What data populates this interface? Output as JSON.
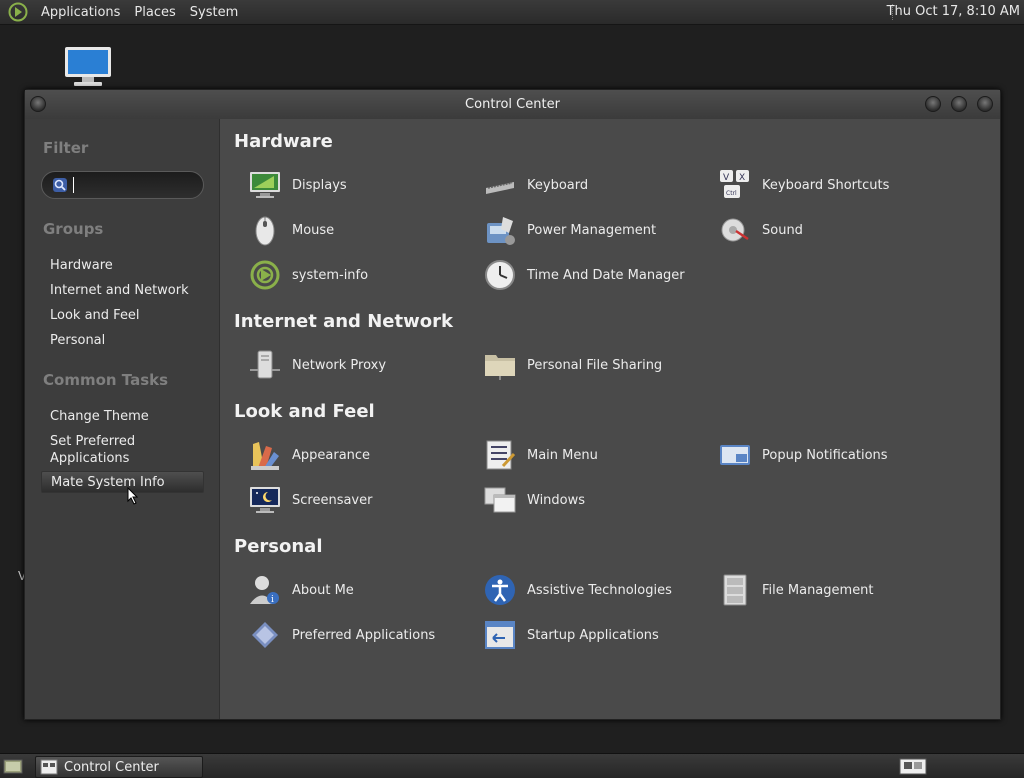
{
  "top_panel": {
    "menus": [
      "Applications",
      "Places",
      "System"
    ],
    "clock": "Thu Oct 17,  8:10 AM"
  },
  "desktop": {
    "stray_text": "V"
  },
  "window": {
    "title": "Control Center",
    "sidebar": {
      "filter_title": "Filter",
      "filter_value": "",
      "groups_title": "Groups",
      "groups": [
        "Hardware",
        "Internet and Network",
        "Look and Feel",
        "Personal"
      ],
      "tasks_title": "Common Tasks",
      "tasks": [
        "Change Theme",
        "Set Preferred\nApplications",
        "Mate System Info"
      ],
      "selected_task": "Mate System Info"
    },
    "groups": [
      {
        "title": "Hardware",
        "items": [
          {
            "label": "Displays",
            "icon": "display-icon"
          },
          {
            "label": "Keyboard",
            "icon": "keyboard-icon"
          },
          {
            "label": "Keyboard Shortcuts",
            "icon": "keyboard-shortcuts-icon"
          },
          {
            "label": "Mouse",
            "icon": "mouse-icon"
          },
          {
            "label": "Power Management",
            "icon": "power-management-icon"
          },
          {
            "label": "Sound",
            "icon": "sound-icon"
          },
          {
            "label": "system-info",
            "icon": "system-info-icon"
          },
          {
            "label": "Time And Date Manager",
            "icon": "clock-icon"
          }
        ]
      },
      {
        "title": "Internet and Network",
        "items": [
          {
            "label": "Network Proxy",
            "icon": "network-proxy-icon"
          },
          {
            "label": "Personal File Sharing",
            "icon": "folder-share-icon"
          }
        ]
      },
      {
        "title": "Look and Feel",
        "items": [
          {
            "label": "Appearance",
            "icon": "appearance-icon"
          },
          {
            "label": "Main Menu",
            "icon": "main-menu-icon"
          },
          {
            "label": "Popup Notifications",
            "icon": "popup-notifications-icon"
          },
          {
            "label": "Screensaver",
            "icon": "screensaver-icon"
          },
          {
            "label": "Windows",
            "icon": "windows-icon"
          }
        ]
      },
      {
        "title": "Personal",
        "items": [
          {
            "label": "About Me",
            "icon": "about-me-icon"
          },
          {
            "label": "Assistive Technologies",
            "icon": "accessibility-icon"
          },
          {
            "label": "File Management",
            "icon": "file-cabinet-icon"
          },
          {
            "label": "Preferred Applications",
            "icon": "preferred-apps-icon"
          },
          {
            "label": "Startup Applications",
            "icon": "startup-apps-icon"
          }
        ]
      }
    ]
  },
  "taskbar": {
    "task_label": "Control Center"
  },
  "colors": {
    "window_bg": "#4a4a4a",
    "sidebar_bg": "#3d3d3d",
    "section_title": "#7f7f7f"
  }
}
